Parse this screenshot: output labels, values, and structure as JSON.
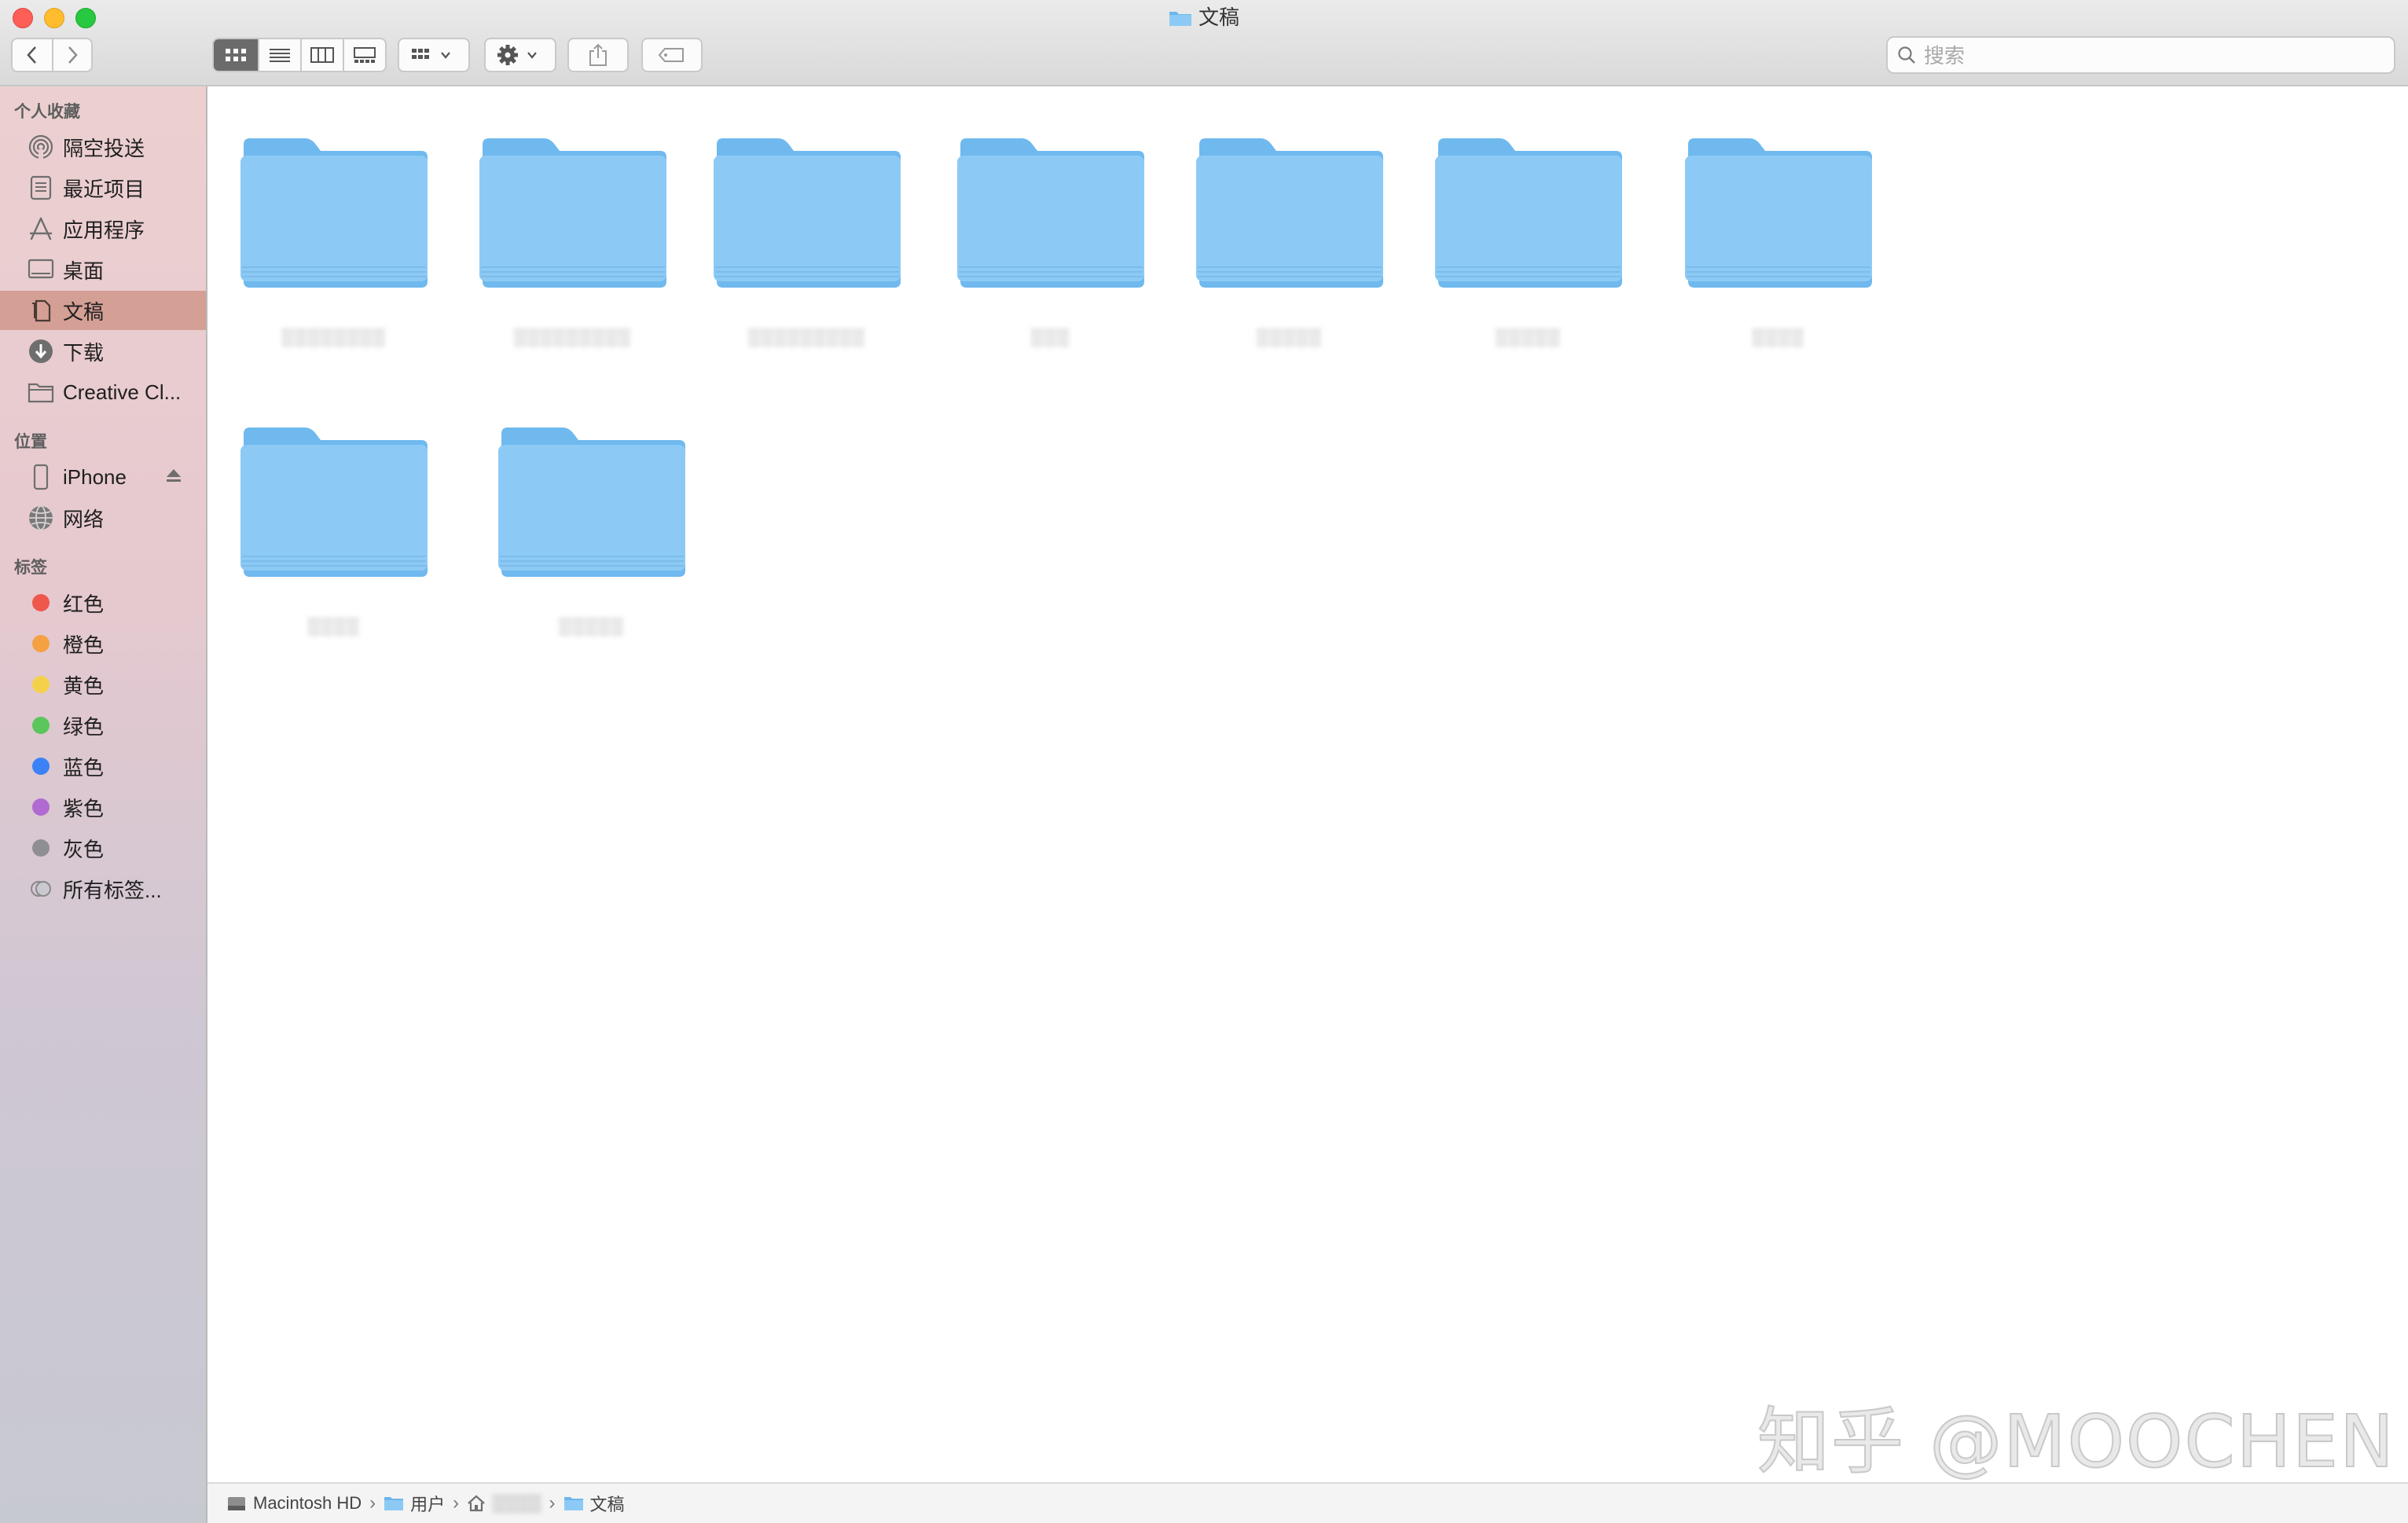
{
  "window": {
    "title": "文稿"
  },
  "toolbar": {
    "search_placeholder": "搜索",
    "view_modes": [
      "icon-view",
      "list-view",
      "column-view",
      "gallery-view"
    ],
    "active_view": "icon-view"
  },
  "sidebar": {
    "sections": [
      {
        "title": "个人收藏",
        "items": [
          {
            "label": "隔空投送",
            "icon": "airdrop-icon"
          },
          {
            "label": "最近项目",
            "icon": "recents-icon"
          },
          {
            "label": "应用程序",
            "icon": "applications-icon"
          },
          {
            "label": "桌面",
            "icon": "desktop-icon"
          },
          {
            "label": "文稿",
            "icon": "documents-icon",
            "selected": true
          },
          {
            "label": "下载",
            "icon": "downloads-icon"
          },
          {
            "label": "Creative Cl...",
            "icon": "folder-icon"
          }
        ]
      },
      {
        "title": "位置",
        "items": [
          {
            "label": "iPhone",
            "icon": "iphone-icon"
          },
          {
            "label": "网络",
            "icon": "network-icon"
          }
        ]
      },
      {
        "title": "标签",
        "items": [
          {
            "label": "红色",
            "color": "#f0574c"
          },
          {
            "label": "橙色",
            "color": "#f5a142"
          },
          {
            "label": "黄色",
            "color": "#f4d14a"
          },
          {
            "label": "绿色",
            "color": "#5bc65b"
          },
          {
            "label": "蓝色",
            "color": "#3b82f6"
          },
          {
            "label": "紫色",
            "color": "#b06ad1"
          },
          {
            "label": "灰色",
            "color": "#8e8e93"
          },
          {
            "label": "所有标签...",
            "color": ""
          }
        ]
      }
    ]
  },
  "content": {
    "folders": [
      {
        "name": "░░░░░░░░",
        "redacted": true
      },
      {
        "name": "░░░░░░░░░",
        "redacted": true
      },
      {
        "name": "░░░░░░░░░",
        "redacted": true
      },
      {
        "name": "░░░",
        "redacted": true
      },
      {
        "name": "░░░░░",
        "redacted": true
      },
      {
        "name": "░░░░░",
        "redacted": true
      },
      {
        "name": "░░░░",
        "redacted": true
      },
      {
        "name": "░░░░",
        "redacted": true
      },
      {
        "name": "░░░░░",
        "redacted": true
      }
    ]
  },
  "watermark": "知乎 @MOOCHEN",
  "pathbar": {
    "crumbs": [
      {
        "label": "Macintosh HD",
        "icon": "hard-drive-icon"
      },
      {
        "label": "用户",
        "icon": "folder-icon"
      },
      {
        "label": "░░░░",
        "icon": "home-icon",
        "redacted": true
      },
      {
        "label": "文稿",
        "icon": "folder-icon"
      }
    ]
  }
}
